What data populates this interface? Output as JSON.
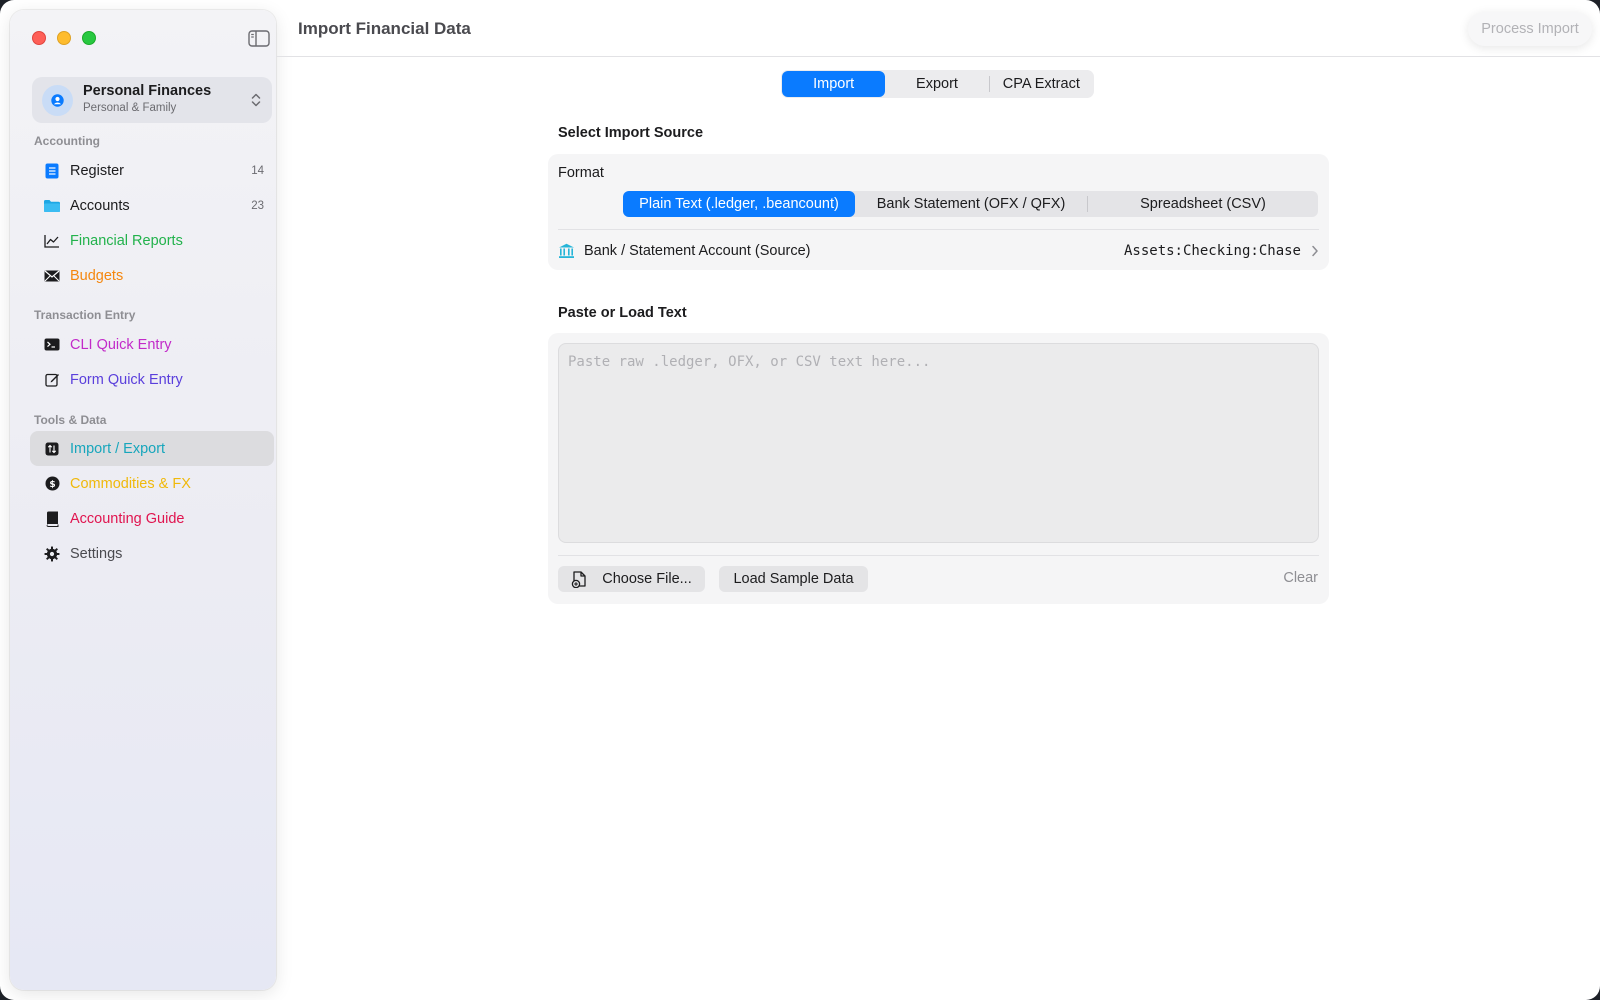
{
  "window": {
    "title": "Import Financial Data",
    "process_button": "Process Import"
  },
  "profile": {
    "name": "Personal Finances",
    "subtitle": "Personal & Family"
  },
  "sidebar": {
    "sections": {
      "accounting": "Accounting",
      "transaction_entry": "Transaction Entry",
      "tools_data": "Tools & Data"
    },
    "items": {
      "register": {
        "label": "Register",
        "count": "14",
        "color": "#1c1c1e",
        "icon": "list-icon"
      },
      "accounts": {
        "label": "Accounts",
        "count": "23",
        "color": "#1c1c1e",
        "icon": "folder-icon"
      },
      "financial_reports": {
        "label": "Financial Reports",
        "color": "#22b24c",
        "icon": "line-chart-icon"
      },
      "budgets": {
        "label": "Budgets",
        "color": "#f5870e",
        "icon": "envelope-icon"
      },
      "cli_quick_entry": {
        "label": "CLI Quick Entry",
        "color": "#c22bc9",
        "icon": "terminal-icon"
      },
      "form_quick_entry": {
        "label": "Form Quick Entry",
        "color": "#5a3fdc",
        "icon": "edit-icon"
      },
      "import_export": {
        "label": "Import / Export",
        "color": "#17a6bc",
        "icon": "arrows-updown-icon"
      },
      "commodities_fx": {
        "label": "Commodities & FX",
        "color": "#f0b90b",
        "icon": "dollar-circle-icon"
      },
      "accounting_guide": {
        "label": "Accounting Guide",
        "color": "#e0144f",
        "icon": "book-icon"
      },
      "settings": {
        "label": "Settings",
        "color": "#4a4a4f",
        "icon": "gear-icon"
      }
    },
    "active": "import_export"
  },
  "tabs": {
    "items": [
      "Import",
      "Export",
      "CPA Extract"
    ],
    "active": "Import"
  },
  "import_source": {
    "heading": "Select Import Source",
    "format_label": "Format",
    "formats": [
      "Plain Text (.ledger, .beancount)",
      "Bank Statement (OFX / QFX)",
      "Spreadsheet (CSV)"
    ],
    "selected_format": "Plain Text (.ledger, .beancount)",
    "account_label": "Bank / Statement Account (Source)",
    "account_value": "Assets:Checking:Chase"
  },
  "paste": {
    "heading": "Paste or Load Text",
    "placeholder": "Paste raw .ledger, OFX, or CSV text here...",
    "choose_file": "Choose File...",
    "load_sample": "Load Sample Data",
    "clear": "Clear"
  },
  "colors": {
    "accent": "#0a7bff"
  }
}
